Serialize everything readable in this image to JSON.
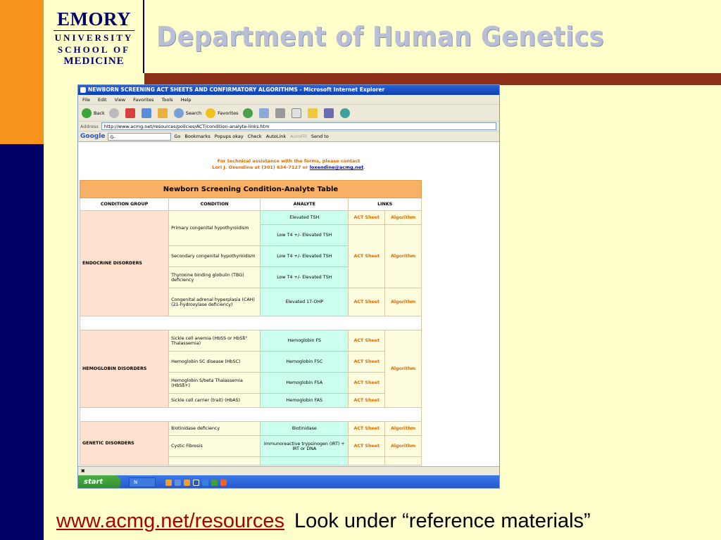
{
  "logo": {
    "line1": "EMORY",
    "line2": "UNIVERSITY",
    "line3": "SCHOOL OF",
    "line4": "MEDICINE"
  },
  "slide_title": "Department of Human Genetics",
  "browser": {
    "window_title": "NEWBORN SCREENING ACT SHEETS AND CONFIRMATORY ALGORITHMS - Microsoft Internet Explorer",
    "menu": [
      "File",
      "Edit",
      "View",
      "Favorites",
      "Tools",
      "Help"
    ],
    "toolbar": {
      "back": "Back",
      "search": "Search",
      "favorites": "Favorites"
    },
    "address_label": "Address",
    "address_value": "http://www.acmg.net/resources/policies/ACT/condition-analyte-links.htm",
    "google": {
      "logo": "Google",
      "input": "G-",
      "go": "Go",
      "bookmarks": "Bookmarks",
      "popups": "Popups okay",
      "check": "Check",
      "autolink": "AutoLink",
      "autofill": "AutoFill",
      "sendto": "Send to"
    },
    "contact_line1": "For technical assistance with the forms, please contact",
    "contact_line2": "Lori J. Oxendine at (301) 634-7127 or",
    "contact_email": "loxendine@acmg.net",
    "table": {
      "title": "Newborn Screening Condition-Analyte Table",
      "headers": [
        "CONDITION GROUP",
        "CONDITION",
        "ANALYTE",
        "LINKS"
      ],
      "act_label": "ACT Sheet",
      "alg_label": "Algorithm",
      "groups": {
        "endocrine": "ENDOCRINE DISORDERS",
        "hemoglobin": "HEMOGLOBIN DISORDERS",
        "genetic": "GENETIC DISORDERS"
      },
      "cells": {
        "c1": "Primary congenital hypothyroidism",
        "a1a": "Elevated TSH",
        "a1b": "Low T4 +/- Elevated TSH",
        "c2": "Secondary congenital hypothyroidism",
        "a2": "Low T4 +/- Elevated TSH",
        "c3": "Thyroxine binding globulin (TBG) deficiency",
        "a3": "Low T4 +/- Elevated TSH",
        "c4": "Congenital adrenal hyperplasia (CAH) (21-hydroxylase deficiency)",
        "a4": "Elevated 17-OHP",
        "c5": "Sickle cell anemia (HbSS or HbSß° Thalassemia)",
        "a5": "Hemoglobin FS",
        "c6": "Hemoglobin SC disease (HbSC)",
        "a6": "Hemoglobin FSC",
        "c7": "Hemoglobin S/beta Thalassemia (HbSß+)",
        "a7": "Hemoglobin FSA",
        "c8": "Sickle cell carrier (trait) (HbAS)",
        "a8": "Hemoglobin FAS",
        "c9": "Biotinidase deficiency",
        "a9": "Biotinidase",
        "c10": "Cystic Fibrosis",
        "a10": "Immunoreactive trypsinogen (IRT) + IRT or DNA"
      }
    },
    "taskbar": {
      "start": "start",
      "item": "N"
    }
  },
  "caption": {
    "link": "www.acmg.net/resources",
    "note": "Look under “reference materials”"
  },
  "colors": {
    "orange": "#f7941d",
    "navy": "#000066",
    "maroon": "#8b2f1a",
    "slide_bg": "#ffffcc"
  }
}
